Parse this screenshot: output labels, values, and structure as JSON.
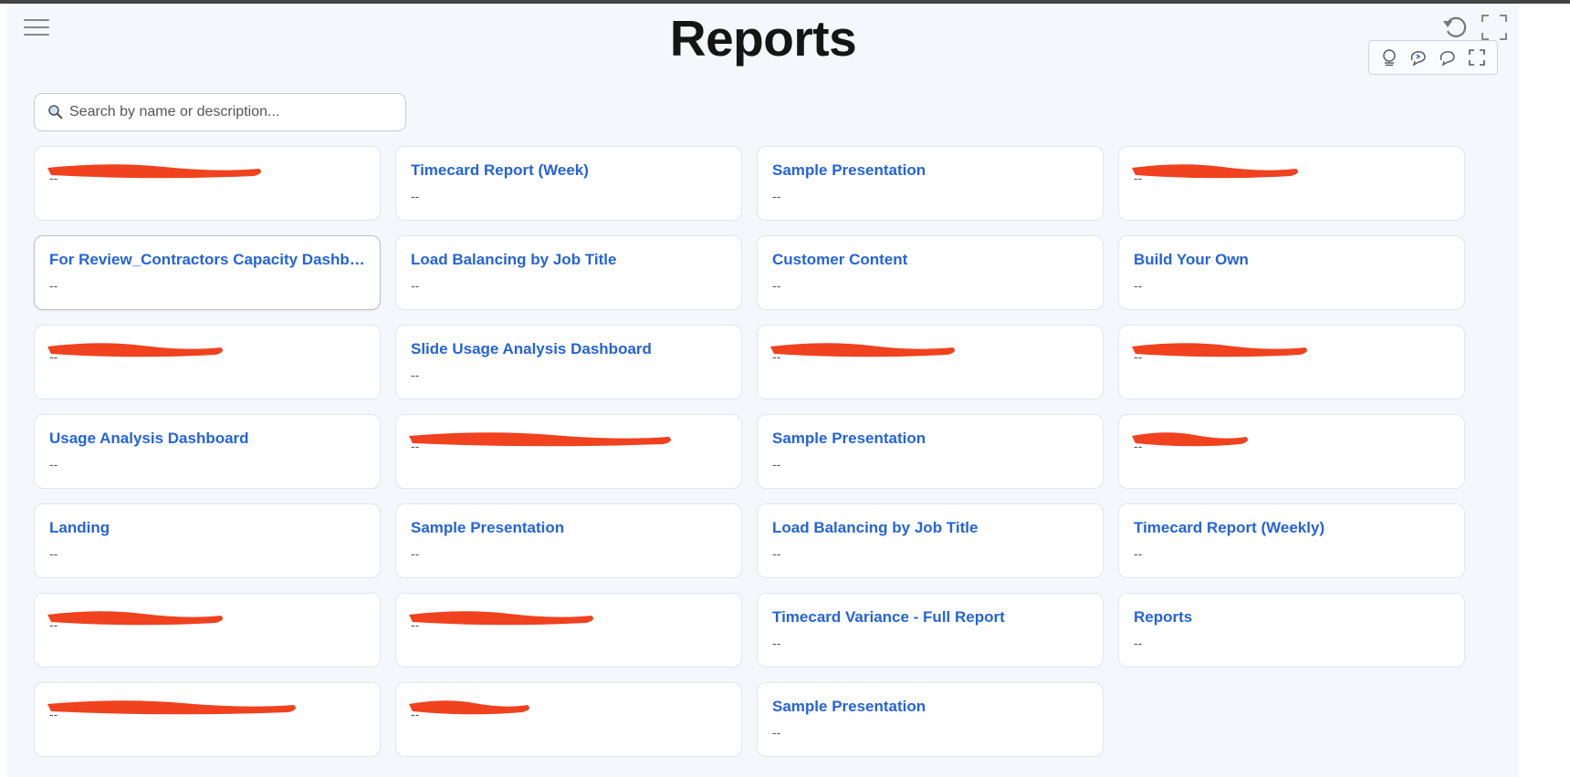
{
  "page": {
    "title": "Reports"
  },
  "search": {
    "placeholder": "Search by name or description...",
    "value": ""
  },
  "cards": [
    {
      "title": "",
      "description": "--",
      "redacted": true
    },
    {
      "title": "Timecard Report (Week)",
      "description": "--"
    },
    {
      "title": "Sample Presentation",
      "description": "--"
    },
    {
      "title": "",
      "description": "--",
      "redacted": true
    },
    {
      "title": "For Review_Contractors Capacity Dashboard",
      "description": "--",
      "active": true
    },
    {
      "title": "Load Balancing by Job Title",
      "description": "--"
    },
    {
      "title": "Customer Content",
      "description": "--"
    },
    {
      "title": "Build Your Own",
      "description": "--"
    },
    {
      "title": "",
      "description": "--",
      "redacted": true
    },
    {
      "title": "Slide Usage Analysis Dashboard",
      "description": "--"
    },
    {
      "title": "",
      "description": "--",
      "redacted": true
    },
    {
      "title": "",
      "description": "--",
      "redacted": true
    },
    {
      "title": "Usage Analysis Dashboard",
      "description": "--"
    },
    {
      "title": "",
      "description": "--",
      "redacted": true
    },
    {
      "title": "Sample Presentation",
      "description": "--"
    },
    {
      "title": "",
      "description": "--",
      "redacted": true
    },
    {
      "title": "Landing",
      "description": "--"
    },
    {
      "title": "Sample Presentation",
      "description": "--"
    },
    {
      "title": "Load Balancing by Job Title",
      "description": "--"
    },
    {
      "title": "Timecard Report (Weekly)",
      "description": "--"
    },
    {
      "title": "",
      "description": "--",
      "redacted": true
    },
    {
      "title": "",
      "description": "--",
      "redacted": true
    },
    {
      "title": "Timecard Variance - Full Report",
      "description": "--"
    },
    {
      "title": "Reports",
      "description": "--"
    },
    {
      "title": "",
      "description": "--",
      "redacted": true
    },
    {
      "title": "",
      "description": "--",
      "redacted": true
    },
    {
      "title": "Sample Presentation",
      "description": "--"
    }
  ],
  "colors": {
    "link": "#2563d9",
    "redaction": "#f0421f",
    "background": "#f6f7fc"
  },
  "icons": [
    "menu-icon",
    "reset-icon",
    "fullscreen-icon",
    "lightbulb-icon",
    "refresh-comment-icon",
    "comment-icon",
    "expand-icon",
    "search-icon"
  ]
}
